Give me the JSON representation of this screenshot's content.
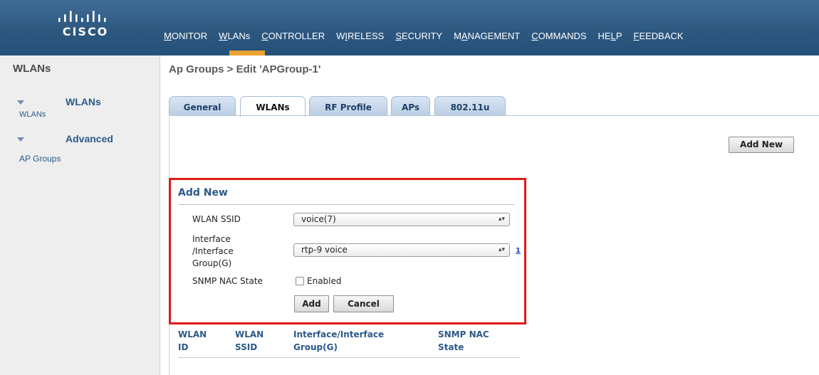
{
  "brand": {
    "name": "CISCO"
  },
  "nav": {
    "items": [
      {
        "label": "MONITOR",
        "hotkey_index": 0,
        "active": false
      },
      {
        "label": "WLANs",
        "hotkey_index": 0,
        "active": true
      },
      {
        "label": "CONTROLLER",
        "hotkey_index": 0,
        "active": false
      },
      {
        "label": "WIRELESS",
        "hotkey_index": 1,
        "active": false
      },
      {
        "label": "SECURITY",
        "hotkey_index": 0,
        "active": false
      },
      {
        "label": "MANAGEMENT",
        "hotkey_index": 1,
        "active": false
      },
      {
        "label": "COMMANDS",
        "hotkey_index": 0,
        "active": false
      },
      {
        "label": "HELP",
        "hotkey_index": 2,
        "active": false
      },
      {
        "label": "FEEDBACK",
        "hotkey_index": 0,
        "active": false
      }
    ],
    "active_color": "#e9a431"
  },
  "sidebar": {
    "title": "WLANs",
    "groups": [
      {
        "label": "WLANs",
        "items": [
          "WLANs"
        ]
      },
      {
        "label": "Advanced",
        "items": [
          "AP Groups"
        ]
      }
    ]
  },
  "page": {
    "title": "Ap Groups > Edit  'APGroup-1'"
  },
  "tabs": [
    {
      "label": "General",
      "active": false
    },
    {
      "label": "WLANs",
      "active": true
    },
    {
      "label": "RF Profile",
      "active": false
    },
    {
      "label": "APs",
      "active": false
    },
    {
      "label": "802.11u",
      "active": false
    }
  ],
  "toolbar": {
    "add_new_label": "Add New"
  },
  "add_new_form": {
    "title": "Add New",
    "wlan_ssid_label": "WLAN SSID",
    "wlan_ssid_value": "voice(7)",
    "interface_label_line1": "Interface",
    "interface_label_line2": "/Interface",
    "interface_label_line3": "Group(G)",
    "interface_value": "rtp-9 voice",
    "interface_help": "1",
    "snmp_label": "SNMP NAC State",
    "snmp_checkbox_label": "Enabled",
    "snmp_checked": false,
    "add_label": "Add",
    "cancel_label": "Cancel",
    "highlight_color": "#e01a1a"
  },
  "table": {
    "columns": [
      {
        "line1": "WLAN",
        "line2": "ID"
      },
      {
        "line1": "WLAN",
        "line2": "SSID"
      },
      {
        "line1": "Interface/Interface",
        "line2": "Group(G)"
      },
      {
        "line1": "SNMP NAC",
        "line2": "State"
      }
    ],
    "rows": []
  },
  "colors": {
    "header_blue": "#2d587f",
    "link_blue": "#2c5a8a",
    "sidebar_bg": "#eeeeee"
  }
}
